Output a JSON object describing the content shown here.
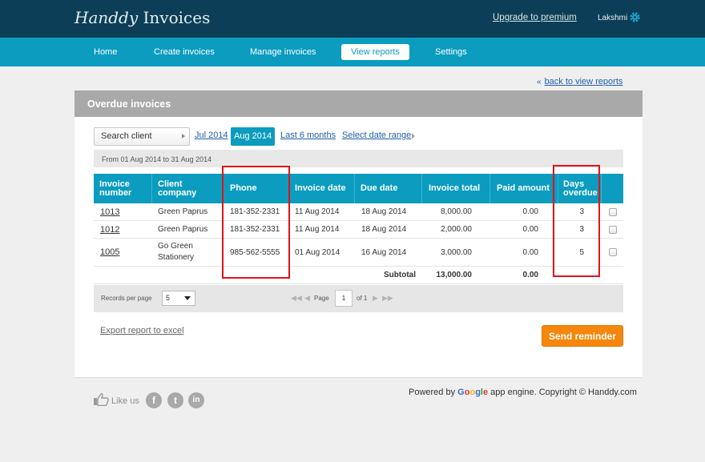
{
  "header": {
    "logo_script": "Handdy",
    "logo_text": "Invoices",
    "upgrade_link": "Upgrade to premium",
    "user_name": "Lakshmi"
  },
  "nav": {
    "items": [
      {
        "label": "Home",
        "active": false
      },
      {
        "label": "Create invoices",
        "active": false
      },
      {
        "label": "Manage invoices",
        "active": false
      },
      {
        "label": "View reports",
        "active": true
      },
      {
        "label": "Settings",
        "active": false
      }
    ]
  },
  "back_link": "back to view reports",
  "panel": {
    "title": "Overdue invoices",
    "search_placeholder": "Search client",
    "filters": [
      "Jul 2014",
      "Aug 2014",
      "Last 6 months",
      "Select date range"
    ],
    "active_filter": "Aug 2014",
    "date_range_text": "From 01 Aug 2014 to 31 Aug 2014"
  },
  "table": {
    "headers": [
      "Invoice number",
      "Client company",
      "Phone",
      "Invoice date",
      "Due date",
      "Invoice total",
      "Paid amount",
      "Days overdue"
    ],
    "rows": [
      {
        "invoice": "1013",
        "client": "Green Paprus",
        "phone": "181-352-2331",
        "invoice_date": "11 Aug 2014",
        "due_date": "18 Aug 2014",
        "total": "8,000.00",
        "paid": "0.00",
        "days": "3"
      },
      {
        "invoice": "1012",
        "client": "Green Paprus",
        "phone": "181-352-2331",
        "invoice_date": "11 Aug 2014",
        "due_date": "18 Aug 2014",
        "total": "2,000.00",
        "paid": "0.00",
        "days": "3"
      },
      {
        "invoice": "1005",
        "client": "Go Green Stationery",
        "phone": "985-562-5555",
        "invoice_date": "01 Aug 2014",
        "due_date": "16 Aug 2014",
        "total": "3,000.00",
        "paid": "0.00",
        "days": "5"
      }
    ],
    "subtotal_label": "Subtotal",
    "subtotal_total": "13,000.00",
    "subtotal_paid": "0.00"
  },
  "pager": {
    "records_label": "Records per page",
    "records_value": "5",
    "page_label": "Page",
    "page_value": "1",
    "of_label": "of 1"
  },
  "export_link": "Export report to excel",
  "send_button": "Send reminder",
  "footer": {
    "like_text": "Like us",
    "social": [
      "f",
      "t",
      "in"
    ],
    "powered_prefix": "Powered by",
    "powered_brand": "Google",
    "powered_suffix": "app engine. Copyright © Handdy.com"
  },
  "colors": {
    "header_bg": "#0c3f57",
    "nav_bg": "#0b9cbf",
    "panel_head": "#a9a9a9",
    "button": "#f5870d",
    "highlight": "#e1121b"
  }
}
